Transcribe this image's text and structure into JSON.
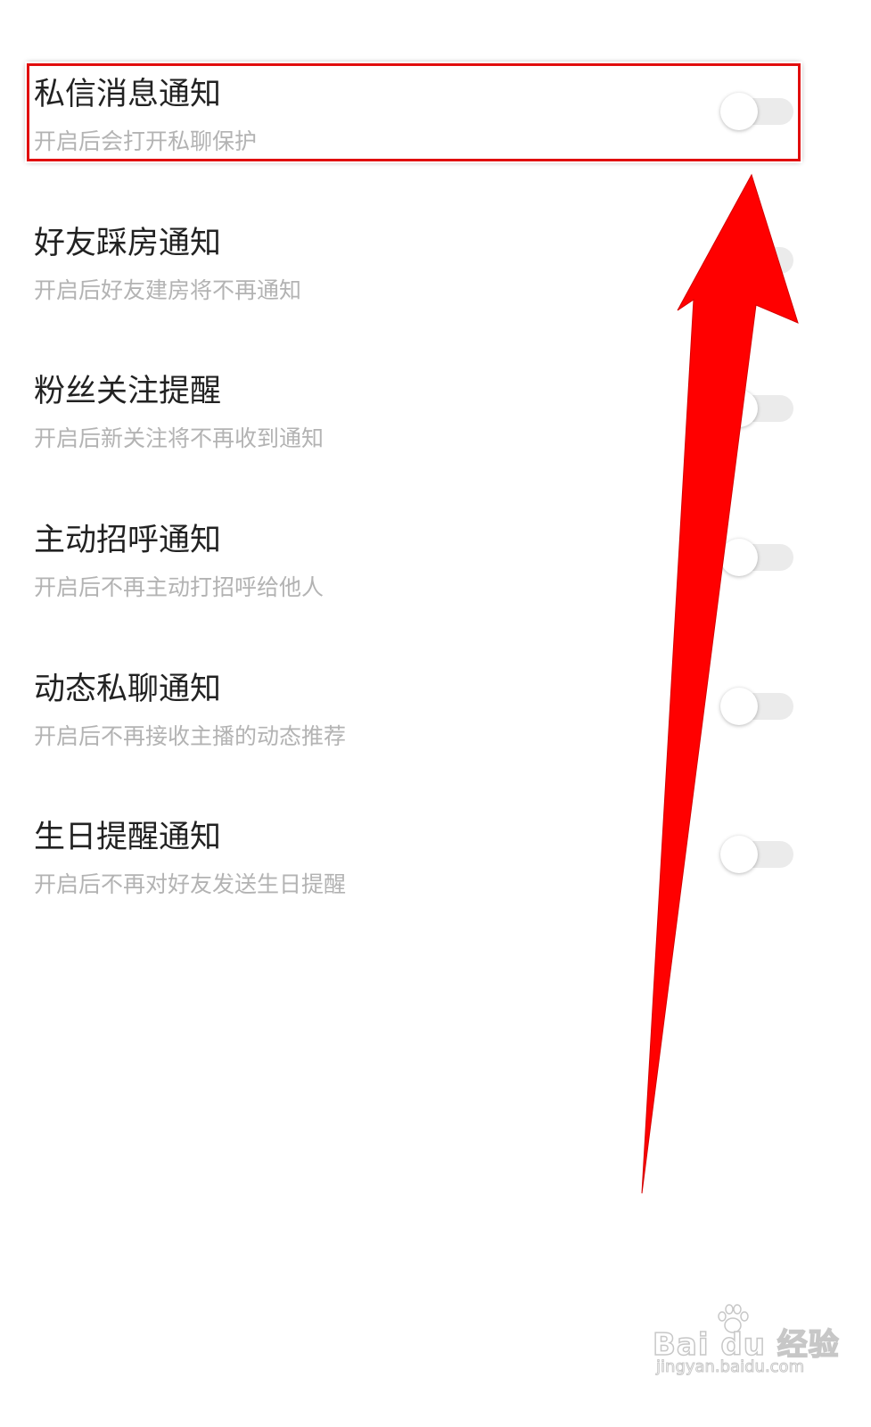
{
  "settings": {
    "items": [
      {
        "title": "私信消息通知",
        "subtitle": "开启后会打开私聊保护",
        "enabled": false
      },
      {
        "title": "好友踩房通知",
        "subtitle": "开启后好友建房将不再通知",
        "enabled": false
      },
      {
        "title": "粉丝关注提醒",
        "subtitle": "开启后新关注将不再收到通知",
        "enabled": false
      },
      {
        "title": "主动招呼通知",
        "subtitle": "开启后不再主动打招呼给他人",
        "enabled": false
      },
      {
        "title": "动态私聊通知",
        "subtitle": "开启后不再接收主播的动态推荐",
        "enabled": false
      },
      {
        "title": "生日提醒通知",
        "subtitle": "开启后不再对好友发送生日提醒",
        "enabled": false
      }
    ]
  },
  "annotation": {
    "highlight_color": "#e10d0d",
    "arrow_color": "#ff0000",
    "highlighted_item": 0
  },
  "watermark": {
    "brand": "Bai du 经验",
    "url": "jingyan.baidu.com"
  },
  "colors": {
    "title": "#222222",
    "subtitle": "#b3b3b3",
    "switch_track": "#ebebeb",
    "switch_knob": "#ffffff"
  }
}
